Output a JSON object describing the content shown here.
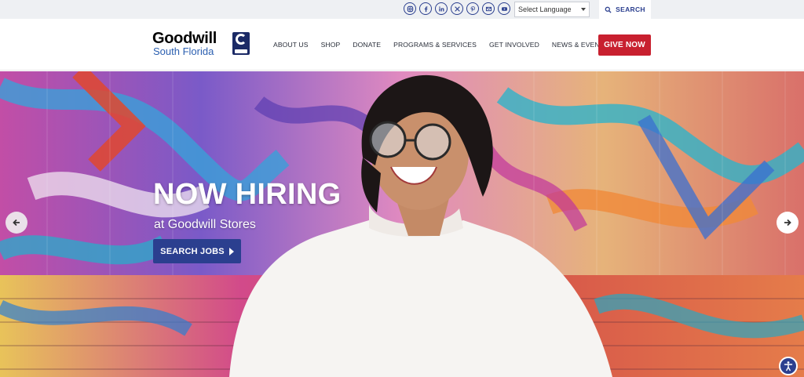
{
  "topbar": {
    "social_icons": [
      "instagram-icon",
      "facebook-icon",
      "linkedin-icon",
      "x-icon",
      "pinterest-icon",
      "email-icon",
      "youtube-icon"
    ],
    "language_select": {
      "selected": "Select Language"
    },
    "search_label": "SEARCH"
  },
  "header": {
    "logo": {
      "word": "Goodwill",
      "region": "South Florida"
    },
    "nav": [
      "ABOUT US",
      "SHOP",
      "DONATE",
      "PROGRAMS & SERVICES",
      "GET INVOLVED",
      "NEWS & EVENTS"
    ],
    "give_label": "GIVE NOW"
  },
  "hero": {
    "title": "NOW HIRING",
    "subtitle": "at Goodwill Stores",
    "cta_label": "SEARCH JOBS"
  },
  "colors": {
    "brand_blue": "#2b3f8f",
    "give_red": "#c8202f",
    "topbar_bg": "#eef0f3"
  }
}
